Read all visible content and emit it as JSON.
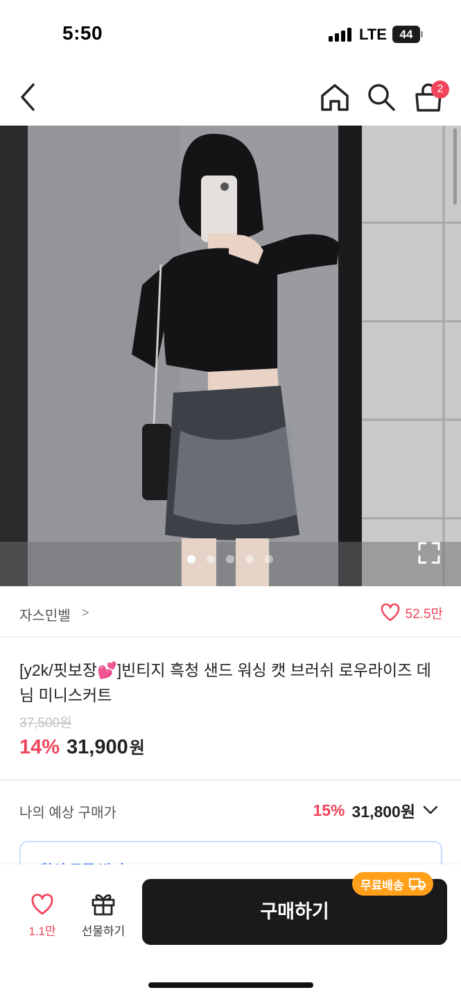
{
  "status_bar": {
    "time": "5:50",
    "carrier": "LTE",
    "battery": "44"
  },
  "nav": {
    "cart_badge": "2",
    "icons": [
      "back-icon",
      "home-icon",
      "search-icon",
      "cart-icon"
    ]
  },
  "gallery": {
    "image_count": 5,
    "active_index": 0
  },
  "seller": {
    "name": "자스민벨",
    "chevron": ">",
    "likes": "52.5만"
  },
  "product": {
    "title_before_emoji": "[y2k/핏보장",
    "title_emoji": "💕",
    "title_after_emoji": "]빈티지 흑청 샌드 워싱 캣 브러쉬 로우라이즈 데님 미니스커트",
    "original_price": "37,500원",
    "discount_rate": "14%",
    "sale_price": "31,900",
    "currency": "원"
  },
  "expected_price": {
    "label": "나의 예상 구매가",
    "discount_rate": "15%",
    "price": "31,800원"
  },
  "coupon": {
    "text": "할인 쿠폰 받기"
  },
  "bottom_bar": {
    "wish_count": "1.1만",
    "gift_label": "선물하기",
    "buy_label": "구매하기",
    "shipping_badge": "무료배송"
  },
  "colors": {
    "accent_red": "#f2445a",
    "buy_button": "#1a1a1a",
    "shipping_badge": "#ff9f1a",
    "coupon_blue": "#3370ff"
  }
}
